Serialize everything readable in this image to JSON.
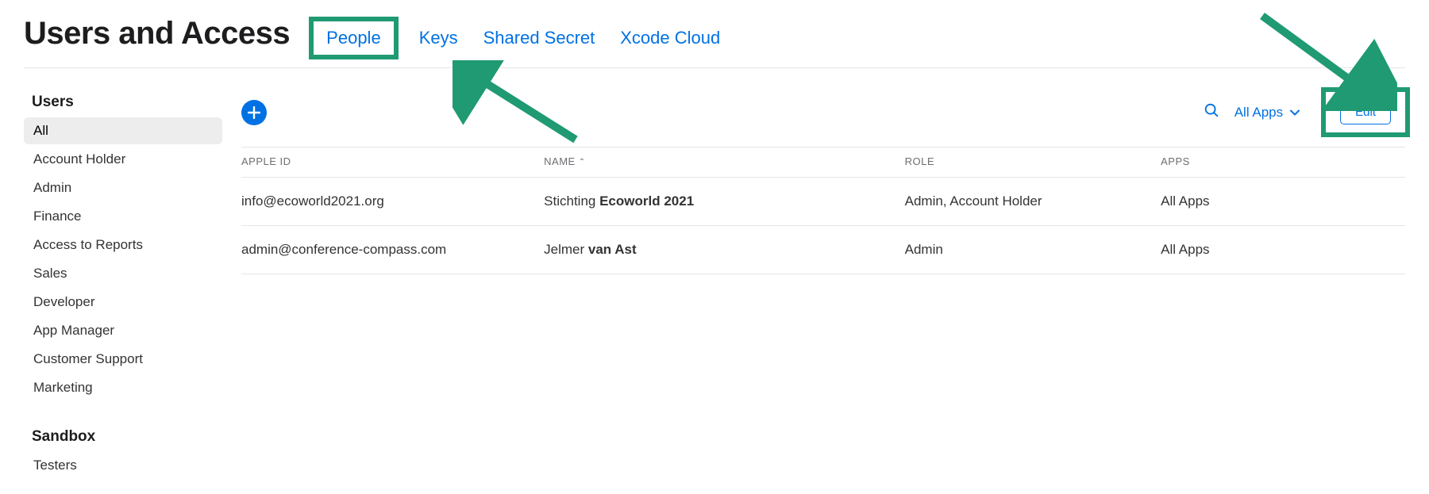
{
  "title": "Users and Access",
  "tabs": {
    "people": "People",
    "keys": "Keys",
    "sharedSecret": "Shared Secret",
    "xcloud": "Xcode Cloud"
  },
  "sidebar": {
    "heading1": "Users",
    "items": [
      "All",
      "Account Holder",
      "Admin",
      "Finance",
      "Access to Reports",
      "Sales",
      "Developer",
      "App Manager",
      "Customer Support",
      "Marketing"
    ],
    "heading2": "Sandbox",
    "items2": [
      "Testers"
    ]
  },
  "toolbar": {
    "filterLabel": "All Apps",
    "editLabel": "Edit"
  },
  "table": {
    "headers": {
      "id": "APPLE ID",
      "name": "NAME",
      "role": "ROLE",
      "apps": "APPS"
    },
    "rows": [
      {
        "id": "info@ecoworld2021.org",
        "nameFirst": "Stichting ",
        "nameBold": "Ecoworld 2021",
        "role": "Admin, Account Holder",
        "apps": "All Apps"
      },
      {
        "id": "admin@conference-compass.com",
        "nameFirst": "Jelmer ",
        "nameBold": "van Ast",
        "role": "Admin",
        "apps": "All Apps"
      }
    ]
  }
}
